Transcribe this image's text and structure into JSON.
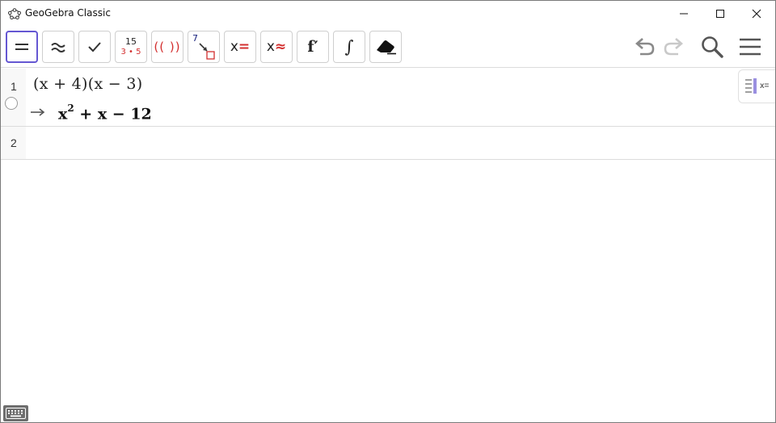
{
  "window": {
    "title": "GeoGebra Classic",
    "app_icon": "geogebra-icon",
    "controls": [
      "minimize-icon",
      "maximize-icon",
      "close-icon"
    ]
  },
  "toolbar": {
    "tools": [
      {
        "name": "evaluate",
        "icon": "equals-icon",
        "active": true
      },
      {
        "name": "numeric",
        "icon": "approx-icon",
        "active": false
      },
      {
        "name": "check",
        "icon": "check-icon",
        "active": false
      },
      {
        "name": "factor-number",
        "icon": "factor-icon",
        "top": "15",
        "bottom": "3 • 5",
        "active": false
      },
      {
        "name": "factor",
        "icon": "factor-brackets-icon",
        "label": "(( ))",
        "active": false
      },
      {
        "name": "substitute",
        "icon": "substitute-icon",
        "label": "7",
        "active": false
      },
      {
        "name": "solve",
        "icon": "solve-icon",
        "label": "x",
        "accent": "=",
        "active": false
      },
      {
        "name": "solve-numerically",
        "icon": "solve-numeric-icon",
        "label": "x",
        "accent": "≈",
        "active": false
      },
      {
        "name": "derivative",
        "icon": "derivative-icon",
        "label": "f′",
        "active": false
      },
      {
        "name": "integral",
        "icon": "integral-icon",
        "label": "∫",
        "active": false
      },
      {
        "name": "delete",
        "icon": "eraser-icon",
        "active": false
      }
    ],
    "right_icons": [
      "undo-icon",
      "redo-icon",
      "search-icon",
      "menu-icon"
    ]
  },
  "algebra": {
    "rows": [
      {
        "number": "1",
        "input": "(x + 4)(x − 3)",
        "output_arrow": "→",
        "output": {
          "base": "x",
          "exponent": "2",
          "rest": " + x − 12"
        }
      },
      {
        "number": "2",
        "input": ""
      }
    ],
    "style_bar_label": "x="
  },
  "colors": {
    "accent": "#6557d2",
    "red": "#d32f2f",
    "blue": "#1a237e",
    "icon_gray": "#666666",
    "icon_dark": "#333333"
  }
}
